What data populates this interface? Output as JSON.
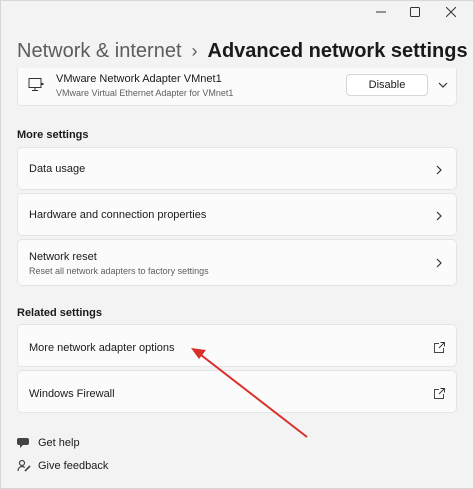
{
  "header": {
    "breadcrumb_parent": "Network & internet",
    "separator": "›",
    "current_page": "Advanced network settings"
  },
  "adapter": {
    "name": "VMware Network Adapter VMnet1",
    "description": "VMware Virtual Ethernet Adapter for VMnet1",
    "disable_label": "Disable",
    "icon": "network-adapter-icon"
  },
  "more_settings": {
    "title": "More settings",
    "items": [
      {
        "label": "Data usage"
      },
      {
        "label": "Hardware and connection properties"
      },
      {
        "label": "Network reset",
        "subtitle": "Reset all network adapters to factory settings"
      }
    ]
  },
  "related_settings": {
    "title": "Related settings",
    "items": [
      {
        "label": "More network adapter options"
      },
      {
        "label": "Windows Firewall"
      }
    ]
  },
  "footer": {
    "get_help": "Get help",
    "give_feedback": "Give feedback"
  },
  "colors": {
    "background": "#f3f3f3",
    "card": "#fbfbfb",
    "annotation_arrow": "#d9302c"
  }
}
